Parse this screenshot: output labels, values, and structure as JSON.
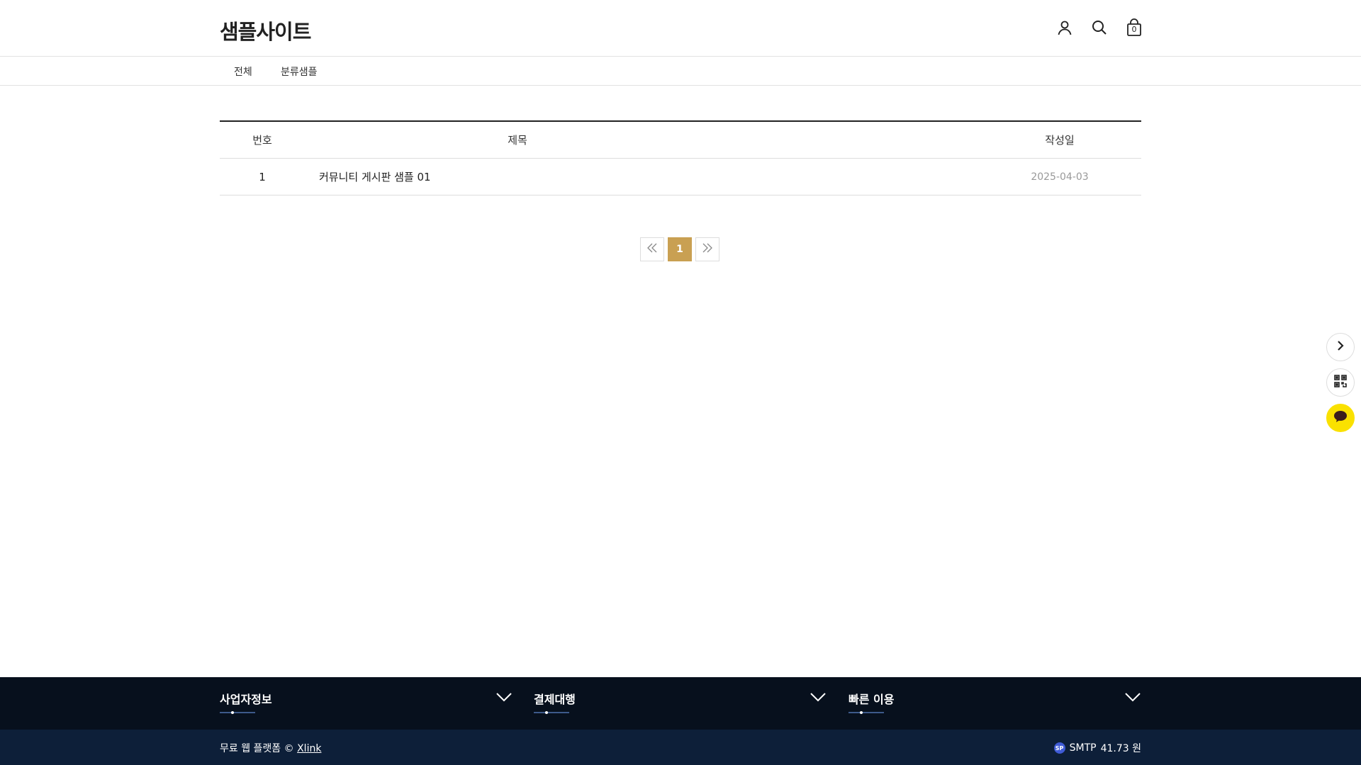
{
  "header": {
    "logo": "샘플사이트",
    "cart_count": "0",
    "icons": [
      "user-icon",
      "search-icon",
      "shopping-bag-icon"
    ]
  },
  "category_nav": {
    "items": [
      {
        "label": "전체"
      },
      {
        "label": "분류샘플"
      }
    ]
  },
  "board": {
    "columns": {
      "no": "번호",
      "title": "제목",
      "date": "작성일"
    },
    "rows": [
      {
        "no": "1",
        "title": "커뮤니티 게시판 샘플 01",
        "date": "2025-04-03"
      }
    ]
  },
  "pagination": {
    "pages": [
      "1"
    ],
    "current": "1",
    "active_color": "#c9a052"
  },
  "side_buttons": [
    "chevron-right-icon",
    "qr-code-icon",
    "chat-bubble-icon"
  ],
  "footer": {
    "sections": [
      {
        "title": "사업자정보"
      },
      {
        "title": "결제대행"
      },
      {
        "title": "빠른 이용"
      }
    ],
    "copyright_prefix": "무료 웹 플랫폼 ©",
    "copyright_link": "Xlink",
    "smtp_label": "SMTP",
    "smtp_value": "41.73 원",
    "colors": {
      "top": "#07101d",
      "bottom": "#0d1f39"
    }
  }
}
